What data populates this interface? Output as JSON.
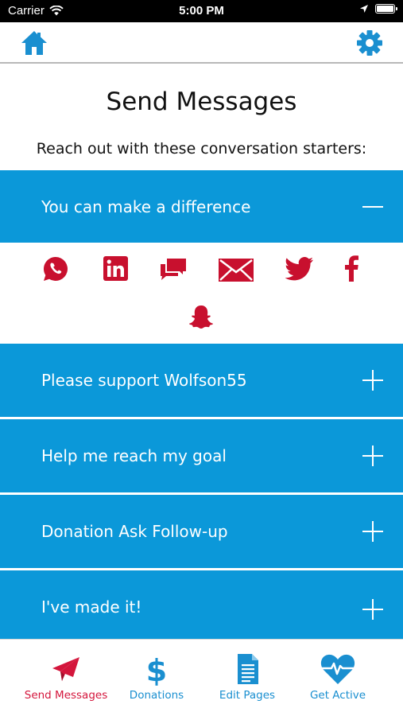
{
  "status_bar": {
    "carrier": "Carrier",
    "time": "5:00 PM"
  },
  "header": {
    "title": "Send Messages",
    "subtitle": "Reach out with these conversation starters:"
  },
  "accordion": [
    {
      "label": "You can make a difference",
      "state": "expanded"
    },
    {
      "label": "Please support Wolfson55",
      "state": "collapsed"
    },
    {
      "label": "Help me reach my goal",
      "state": "collapsed"
    },
    {
      "label": "Donation Ask Follow-up",
      "state": "collapsed"
    },
    {
      "label": "I've made it!",
      "state": "collapsed"
    }
  ],
  "share_icons": [
    "whatsapp-icon",
    "linkedin-icon",
    "sms-icon",
    "email-icon",
    "twitter-icon",
    "facebook-icon",
    "snapchat-icon"
  ],
  "tabs": [
    {
      "label": "Send Messages",
      "icon": "paper-plane-icon",
      "active": true
    },
    {
      "label": "Donations",
      "icon": "dollar-icon",
      "active": false
    },
    {
      "label": "Edit Pages",
      "icon": "document-icon",
      "active": false
    },
    {
      "label": "Get Active",
      "icon": "heart-pulse-icon",
      "active": false
    }
  ],
  "colors": {
    "accent_blue": "#0b98d9",
    "share_red": "#c8102e",
    "active_tab": "#d4163c",
    "inactive_tab": "#1a8fd0"
  }
}
